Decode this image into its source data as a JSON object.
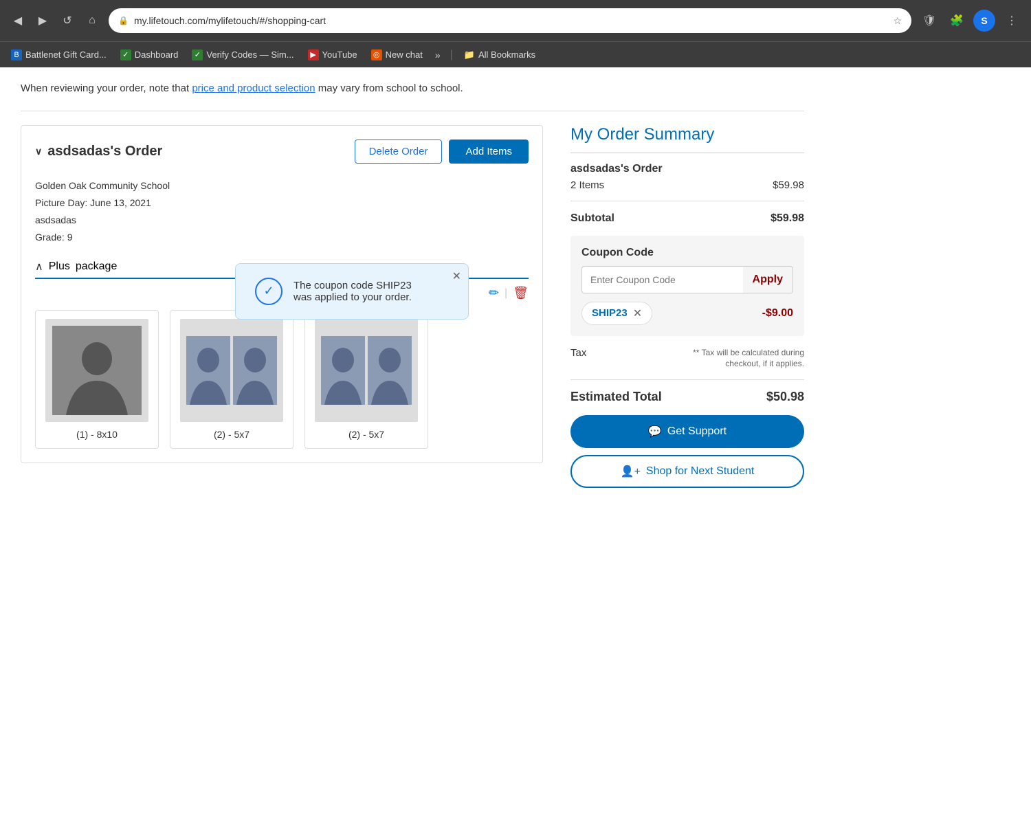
{
  "browser": {
    "url": "my.lifetouch.com/mylifetouch/#/shopping-cart",
    "nav_back": "◀",
    "nav_forward": "▶",
    "nav_reload": "↺",
    "nav_home": "⌂",
    "star_icon": "☆",
    "menu_icon": "⋮",
    "avatar_initial": "S",
    "extension_icon": "🛡",
    "puzzle_icon": "🧩"
  },
  "bookmarks": {
    "items": [
      {
        "label": "Battlenet Gift Card...",
        "icon_char": "B",
        "color_class": "bm-blue"
      },
      {
        "label": "Dashboard",
        "icon_char": "✓",
        "color_class": "bm-green"
      },
      {
        "label": "Verify Codes — Sim...",
        "icon_char": "✓",
        "color_class": "bm-green"
      },
      {
        "label": "YouTube",
        "icon_char": "▶",
        "color_class": "bm-red"
      },
      {
        "label": "New chat",
        "icon_char": "◎",
        "color_class": "bm-orange"
      }
    ],
    "more": "»",
    "all_bookmarks": "All Bookmarks",
    "folder_icon": "📁"
  },
  "page": {
    "notice_text_pre": "When reviewing your order, note that ",
    "notice_link": "price and product selection",
    "notice_text_post": " may vary from school to school."
  },
  "order": {
    "title": "asdsadas's Order",
    "chevron": "∨",
    "delete_btn": "Delete Order",
    "add_items_btn": "Add Items",
    "school": "Golden Oak Community School",
    "picture_day": "Picture Day: June 13, 2021",
    "student_name": "asdsadas",
    "grade": "Grade: 9",
    "package_chevron": "∧",
    "package_label": "Plus",
    "package_type": "package",
    "edit_icon": "✏",
    "delete_icon": "🗑",
    "separator": "|",
    "photos": [
      {
        "label": "(1) - 8x10",
        "type": "8x10"
      },
      {
        "label": "(2) - 5x7",
        "type": "5x7-double"
      },
      {
        "label": "(2) - 5x7",
        "type": "5x7-double"
      }
    ]
  },
  "coupon_toast": {
    "message": "The coupon code SHIP23\nwas applied to your order.",
    "check_icon": "✓",
    "close_icon": "✕"
  },
  "summary": {
    "title": "My Order Summary",
    "order_name": "asdsadas's Order",
    "items_count": "2 Items",
    "items_price": "$59.98",
    "subtotal_label": "Subtotal",
    "subtotal_price": "$59.98",
    "coupon_section_label": "Coupon Code",
    "coupon_placeholder": "Enter Coupon Code",
    "coupon_apply_btn": "Apply",
    "coupon_code": "SHIP23",
    "coupon_remove_icon": "✕",
    "coupon_discount": "-$9.00",
    "tax_label": "Tax",
    "tax_note": "** Tax will be calculated during checkout, if it applies.",
    "estimated_total_label": "Estimated Total",
    "estimated_total_price": "$50.98",
    "support_icon": "💬",
    "get_support_btn": "Get Support",
    "shop_next_icon": "👤+",
    "shop_next_btn": "Shop for Next Student"
  }
}
